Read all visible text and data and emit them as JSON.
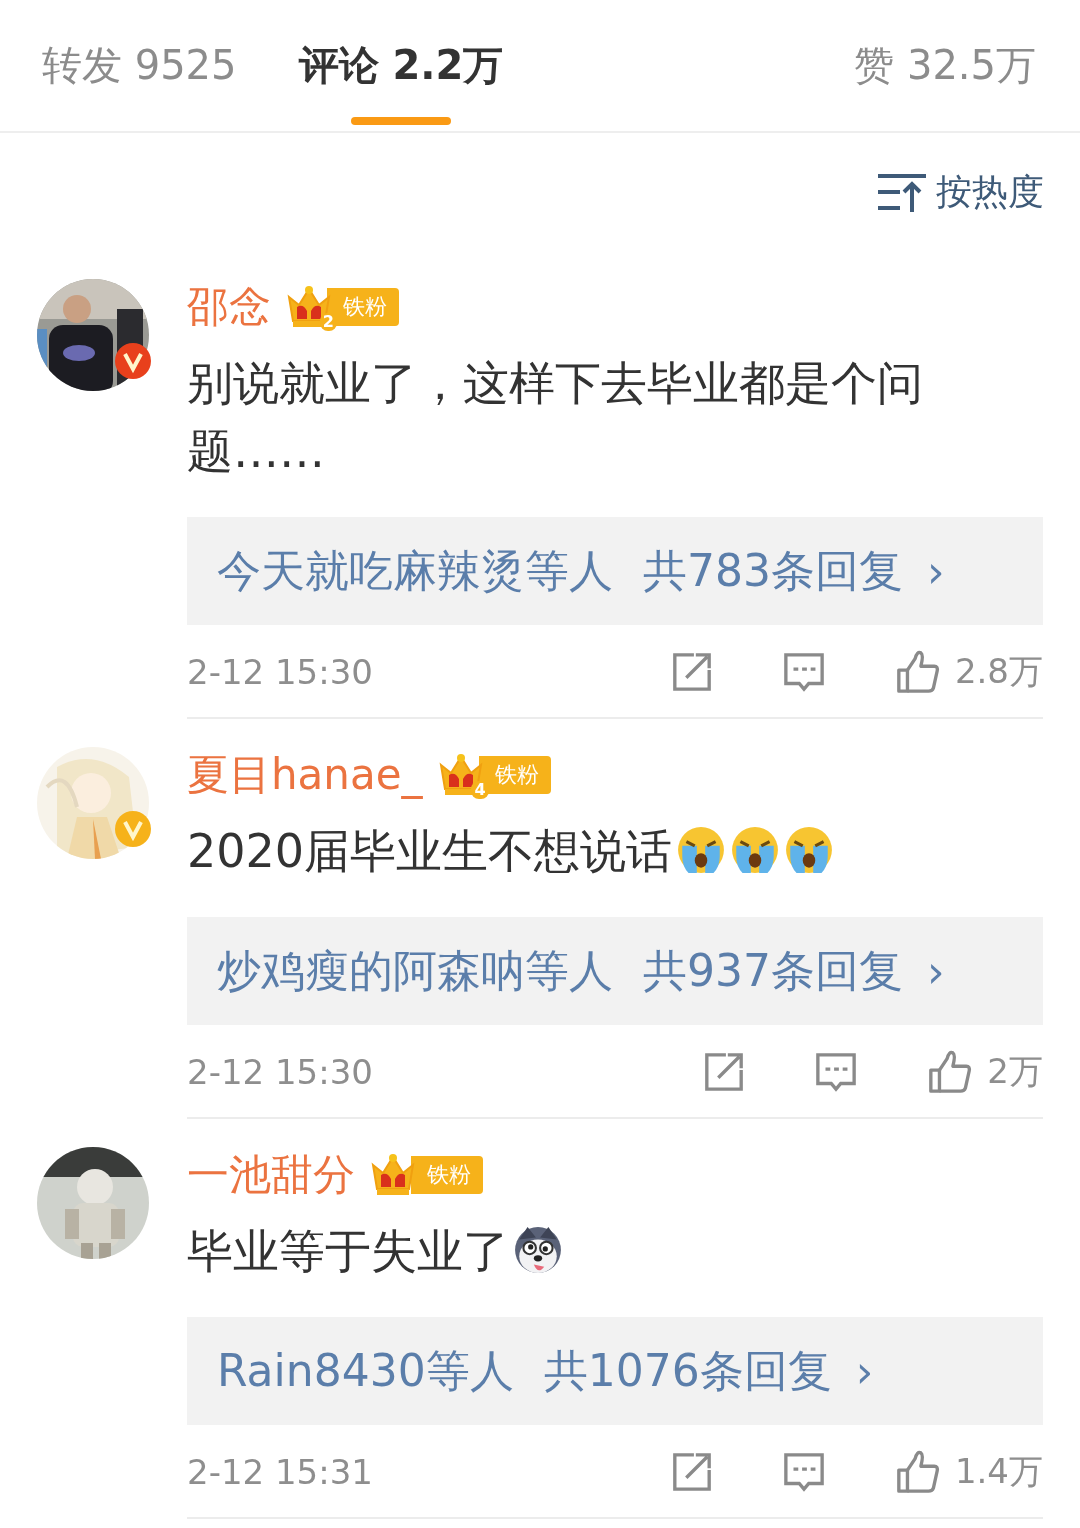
{
  "tabs": [
    {
      "label": "转发 9525",
      "selected": false
    },
    {
      "label": "评论 2.2万",
      "selected": true
    },
    {
      "label": "赞 32.5万",
      "selected": false
    }
  ],
  "sort": {
    "label": "按热度"
  },
  "comments": [
    {
      "name": "邵念",
      "badge": {
        "level": "2",
        "label": "铁粉"
      },
      "verified": {
        "color": "#e8401c"
      },
      "text": "别说就业了，这样下去毕业都是个问题……",
      "replies": {
        "names": "今天就吃麻辣烫等人",
        "count": "共783条回复",
        "arrow": "›"
      },
      "time": "2-12 15:30",
      "likes": "2.8万"
    },
    {
      "name": "夏目hanae_",
      "badge": {
        "level": "4",
        "label": "铁粉"
      },
      "verified": {
        "color": "#f6b21a"
      },
      "text": "2020届毕业生不想说话",
      "inline_icons": [
        {
          "kind": "crying"
        },
        {
          "kind": "crying"
        },
        {
          "kind": "crying"
        }
      ],
      "replies": {
        "names": "炒鸡瘦的阿森呐等人",
        "count": "共937条回复",
        "arrow": "›"
      },
      "time": "2-12 15:30",
      "likes": "2万"
    },
    {
      "name": "一池甜分",
      "badge": {
        "label": "铁粉"
      },
      "text": "毕业等于失业了",
      "inline_icons": [
        {
          "kind": "husky"
        }
      ],
      "replies": {
        "names": "Rain8430等人",
        "count": "共1076条回复",
        "arrow": "›"
      },
      "time": "2-12 15:31",
      "likes": "1.4万"
    }
  ]
}
